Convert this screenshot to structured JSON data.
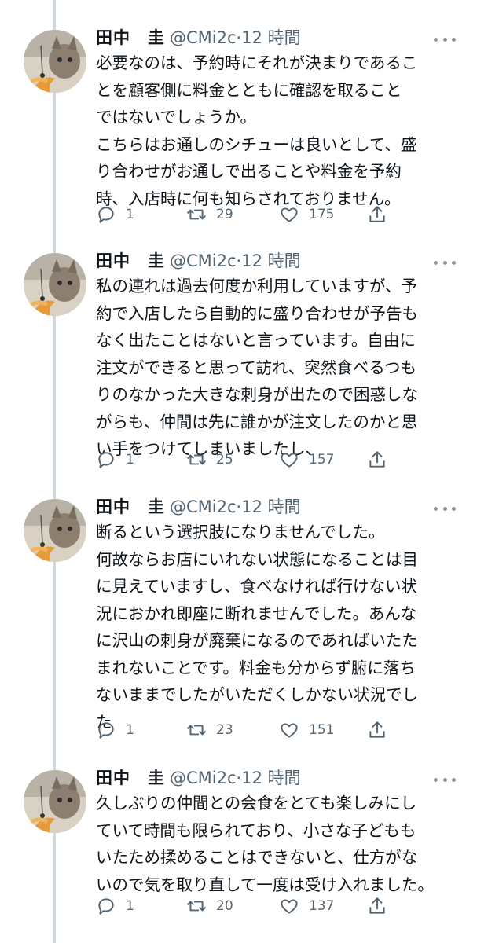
{
  "tweets": [
    {
      "name_family": "田中",
      "name_given": "圭",
      "handle": "@CMi2c",
      "separator": "·",
      "time": "12 時間",
      "text": "必要なのは、予約時にそれが決まりであるこ\nとを顧客側に料金とともに確認を取ること\nではないでしょうか。\nこちらはお通しのシチューは良いとして、盛\nり合わせがお通しで出ることや料金を予約\n時、入店時に何も知らされておりません。",
      "replies": "1",
      "retweets": "29",
      "likes": "175"
    },
    {
      "name_family": "田中",
      "name_given": "圭",
      "handle": "@CMi2c",
      "separator": "·",
      "time": "12 時間",
      "text": "私の連れは過去何度か利用していますが、予\n約で入店したら自動的に盛り合わせが予告も\nなく出たことはないと言っています。自由に\n注文ができると思って訪れ、突然食べるつも\nりのなかった大きな刺身が出たので困惑しな\nがらも、仲間は先に誰かが注文したのかと思\nい手をつけてしまいましたし、",
      "replies": "1",
      "retweets": "25",
      "likes": "157"
    },
    {
      "name_family": "田中",
      "name_given": "圭",
      "handle": "@CMi2c",
      "separator": "·",
      "time": "12 時間",
      "text": "断るという選択肢になりませんでした。\n何故ならお店にいれない状態になることは目\nに見えていますし、食べなければ行けない状\n況におかれ即座に断れませんでした。あんな\nに沢山の刺身が廃棄になるのであればいたた\nまれないことです。料金も分からず腑に落ち\nないままでしたがいただくしかない状況でし\nた",
      "replies": "1",
      "retweets": "23",
      "likes": "151"
    },
    {
      "name_family": "田中",
      "name_given": "圭",
      "handle": "@CMi2c",
      "separator": "·",
      "time": "12 時間",
      "text": "久しぶりの仲間との会食をとても楽しみにし\nていて時間も限られており、小さな子どもも\nいたため揉めることはできないと、仕方がな\nいので気を取り直して一度は受け入れました。",
      "replies": "1",
      "retweets": "20",
      "likes": "137"
    }
  ],
  "icons": {
    "reply": "reply-icon",
    "retweet": "retweet-icon",
    "like": "heart-icon",
    "share": "share-icon",
    "more": "more-options-icon"
  },
  "colors": {
    "text": "#0f1419",
    "secondary": "#536471",
    "thread_line": "#cfd9de"
  }
}
